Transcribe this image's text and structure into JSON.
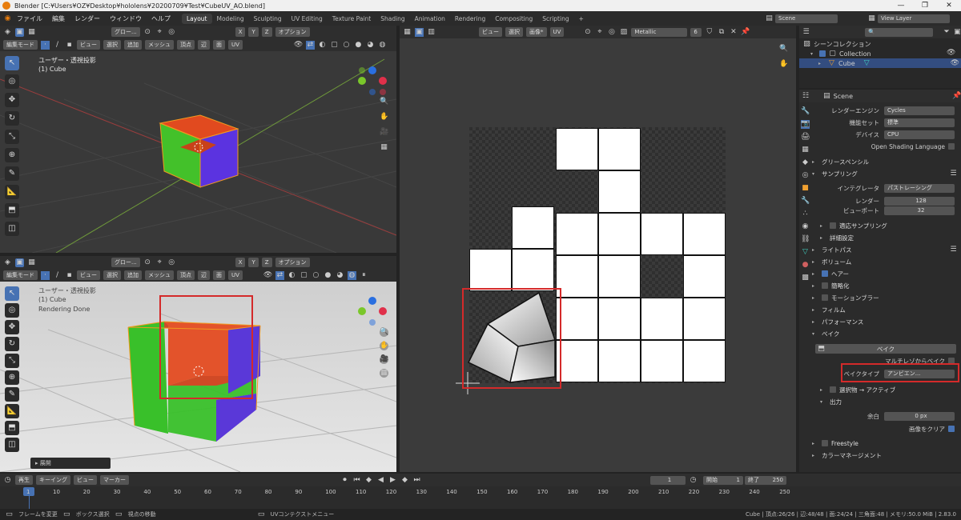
{
  "window": {
    "title": "Blender [C:¥Users¥OZ¥Desktop¥hololens¥20200709¥Test¥CubeUV_AO.blend]"
  },
  "menu": {
    "items": [
      "ファイル",
      "編集",
      "レンダー",
      "ウィンドウ",
      "ヘルプ"
    ]
  },
  "workspaces": [
    "Layout",
    "Modeling",
    "Sculpting",
    "UV Editing",
    "Texture Paint",
    "Shading",
    "Animation",
    "Rendering",
    "Compositing",
    "Scripting"
  ],
  "scene": {
    "name": "Scene",
    "view_layer": "View Layer"
  },
  "viewport_top": {
    "mode": "編集モード",
    "global": "グロー...",
    "options": "オプション",
    "menus": [
      "ビュー",
      "選択",
      "追加",
      "メッシュ",
      "頂点",
      "辺",
      "面",
      "UV"
    ],
    "xyz": [
      "X",
      "Y",
      "Z"
    ],
    "info1": "ユーザー・透視投影",
    "info2": "(1) Cube"
  },
  "viewport_bottom": {
    "mode": "編集モード",
    "global": "グロー...",
    "options": "オプション",
    "menus": [
      "ビュー",
      "選択",
      "追加",
      "メッシュ",
      "頂点",
      "辺",
      "面",
      "UV"
    ],
    "xyz": [
      "X",
      "Y",
      "Z"
    ],
    "info1": "ユーザー・透視投影",
    "info2": "(1) Cube",
    "info3": "Rendering Done",
    "expand": "展開"
  },
  "uv_editor": {
    "menus": [
      "ビュー",
      "選択",
      "画像*",
      "UV"
    ],
    "image": "Metallic",
    "users": "6"
  },
  "outliner": {
    "scene_collection": "シーンコレクション",
    "collection": "Collection",
    "cube": "Cube"
  },
  "properties": {
    "scene": "Scene",
    "render_engine_label": "レンダーエンジン",
    "render_engine": "Cycles",
    "feature_set_label": "機能セット",
    "feature_set": "標準",
    "device_label": "デバイス",
    "device": "CPU",
    "osl": "Open Shading Language",
    "grease_pencil": "グリースペンシル",
    "sampling": "サンプリング",
    "integrator_label": "インテグレータ",
    "integrator": "パストレーシング",
    "render_label": "レンダー",
    "render_samples": "128",
    "viewport_label": "ビューポート",
    "viewport_samples": "32",
    "adaptive": "適応サンプリング",
    "advanced": "詳細設定",
    "light_paths": "ライトパス",
    "volumes": "ボリューム",
    "hair": "ヘアー",
    "simplify": "簡略化",
    "motion_blur": "モーションブラー",
    "film": "フィルム",
    "performance": "パフォーマンス",
    "bake": "ベイク",
    "bake_button": "ベイク",
    "multires": "マルチレゾからベイク",
    "bake_type_label": "ベイクタイプ",
    "bake_type": "アンビエン...",
    "selected_to_active": "選択物 → アクティブ",
    "output": "出力",
    "margin_label": "余白",
    "margin": "0 px",
    "clear_image": "画像をクリア",
    "freestyle": "Freestyle",
    "color_management": "カラーマネージメント"
  },
  "timeline": {
    "playback": "再生",
    "keying": "キーイング",
    "view": "ビュー",
    "marker": "マーカー",
    "current_frame": "1",
    "start_label": "開始",
    "start": "1",
    "end_label": "終了",
    "end": "250",
    "ticks": [
      "1",
      "10",
      "20",
      "30",
      "40",
      "50",
      "60",
      "70",
      "80",
      "90",
      "100",
      "110",
      "120",
      "130",
      "140",
      "150",
      "160",
      "170",
      "180",
      "190",
      "200",
      "210",
      "220",
      "230",
      "240",
      "250"
    ]
  },
  "status": {
    "left1": "フレームを変更",
    "left2": "ボックス選択",
    "left3": "視点の移動",
    "middle": "UVコンテクストメニュー",
    "right": "Cube | 頂点:26/26 | 辺:48/48 | 面:24/24 | 三角面:48 | メモリ:50.0 MiB | 2.83.0"
  }
}
